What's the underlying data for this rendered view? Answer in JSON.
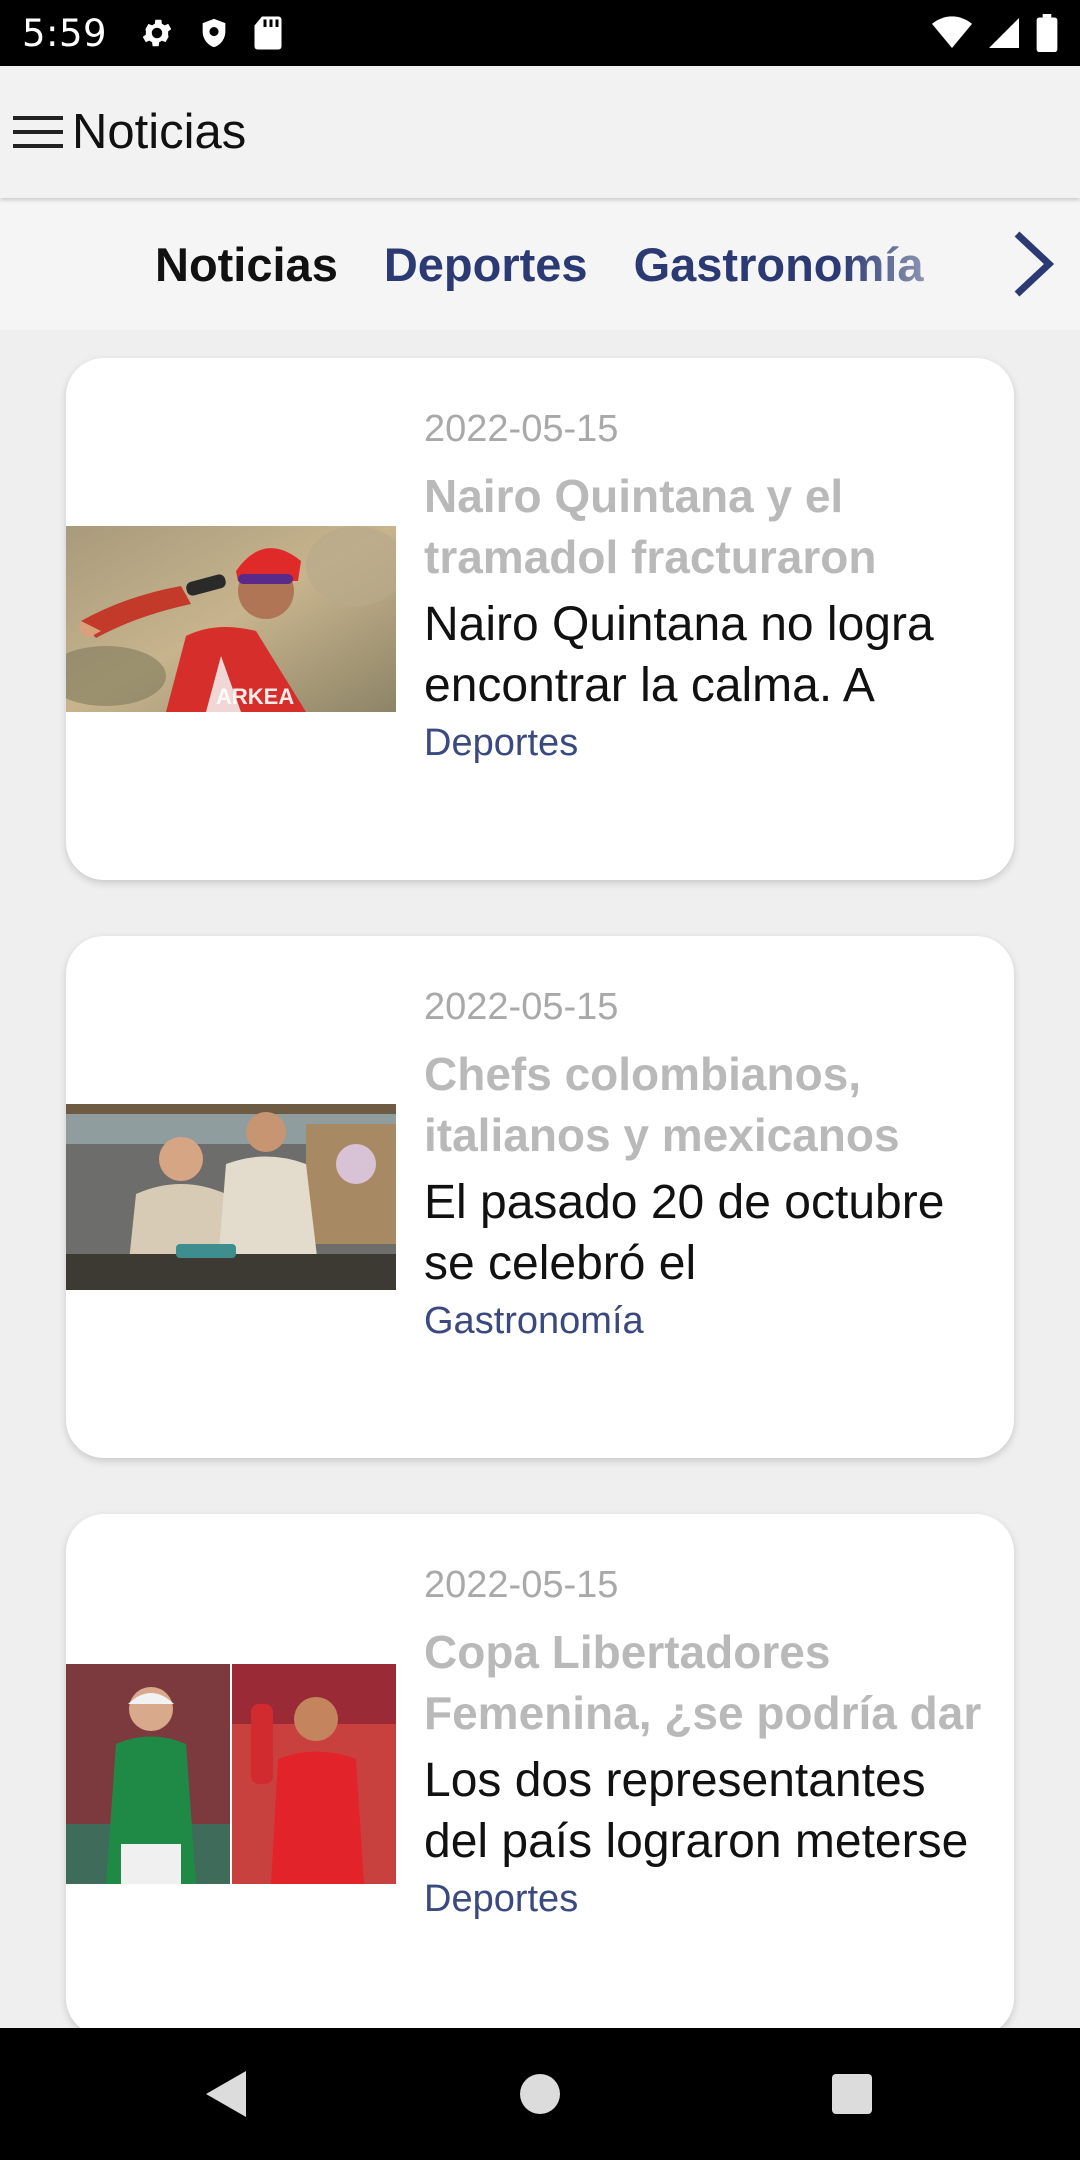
{
  "status_bar": {
    "time": "5:59",
    "icons_left": [
      "gear-icon",
      "shield-icon",
      "sd-card-icon"
    ],
    "icons_right": [
      "wifi-icon",
      "cellular-signal-icon",
      "battery-icon"
    ]
  },
  "app_bar": {
    "title": "Noticias",
    "menu_icon": "hamburger-menu-icon"
  },
  "tabs": {
    "items": [
      {
        "label": "Noticias",
        "active": true
      },
      {
        "label": "Deportes",
        "active": false
      },
      {
        "label": "Gastronomía",
        "active": false
      }
    ],
    "next_icon": "chevron-right-icon",
    "active_color": "#111111",
    "inactive_color": "#2b3a73"
  },
  "articles": [
    {
      "date": "2022-05-15",
      "title": "Nairo Quintana y el tramadol fracturaron",
      "excerpt": "Nairo Quintana no logra encontrar la calma. A",
      "category": "Deportes",
      "image": "cyclist-drinking-photo"
    },
    {
      "date": "2022-05-15",
      "title": "Chefs colombianos, italianos y mexicanos",
      "excerpt": "El pasado 20 de octubre se celebró el",
      "category": "Gastronomía",
      "image": "chefs-cooking-photo"
    },
    {
      "date": "2022-05-15",
      "title": "Copa Libertadores Femenina, ¿se podría dar",
      "excerpt": "Los dos representantes del país lograron meterse",
      "category": "Deportes",
      "image": "womens-football-players-photo"
    }
  ],
  "nav_bar": {
    "icons": [
      "back-icon",
      "home-icon",
      "recents-icon"
    ]
  }
}
